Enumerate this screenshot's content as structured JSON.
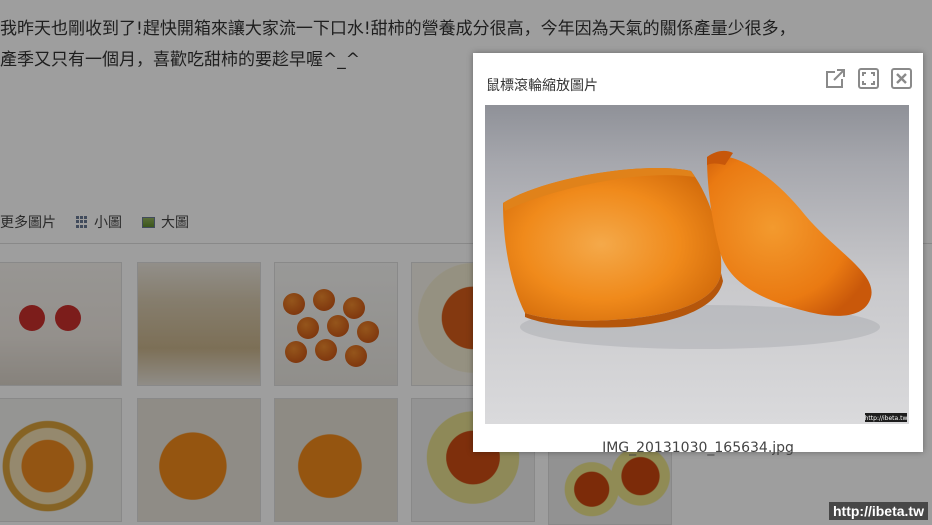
{
  "article": {
    "line1": "我昨天也剛收到了!趕快開箱來讓大家流一下口水!甜柿的營養成分很高，今年因為天氣的關係產量少很多，",
    "line2": "產季又只有一個月，喜歡吃甜柿的要趁早喔^_^"
  },
  "gallery": {
    "more_label": "更多圖片",
    "small_label": "小圖",
    "large_label": "大圖"
  },
  "lightbox": {
    "title": "鼠標滾輪縮放圖片",
    "caption": "IMG_20131030_165634.jpg",
    "image_stamp": "http://ibeta.tw",
    "icons": [
      "external-link-icon",
      "fullscreen-icon",
      "close-icon"
    ]
  },
  "watermark": "http://ibeta.tw",
  "colors": {
    "overlay": "#000000",
    "fruit": "#f08a1b",
    "panel": "#ffffff"
  }
}
